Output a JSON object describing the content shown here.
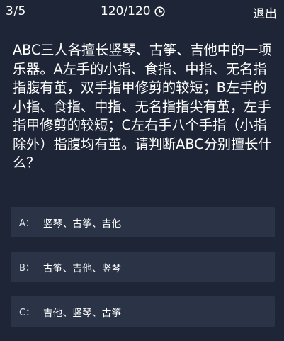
{
  "header": {
    "progress": "3/5",
    "timer": "120/120",
    "timer_icon": "clock-icon",
    "exit_label": "退出"
  },
  "question": {
    "text": "ABC三人各擅长竖琴、古筝、吉他中的一项乐器。A左手的小指、食指、中指、无名指指腹有茧，双手指甲修剪的较短；B左手的小指、食指、中指、无名指指尖有茧，左手指甲修剪的较短；C左右手八个手指（小指除外）指腹均有茧。请判断ABC分别擅长什么？"
  },
  "options": [
    {
      "letter": "A：",
      "text": "竖琴、古筝、吉他"
    },
    {
      "letter": "B：",
      "text": "古筝、吉他、竖琴"
    },
    {
      "letter": "C：",
      "text": "吉他、竖琴、古筝"
    }
  ],
  "colors": {
    "background": "#1e2536",
    "option_background": "#2a3446",
    "text": "#ffffff"
  }
}
